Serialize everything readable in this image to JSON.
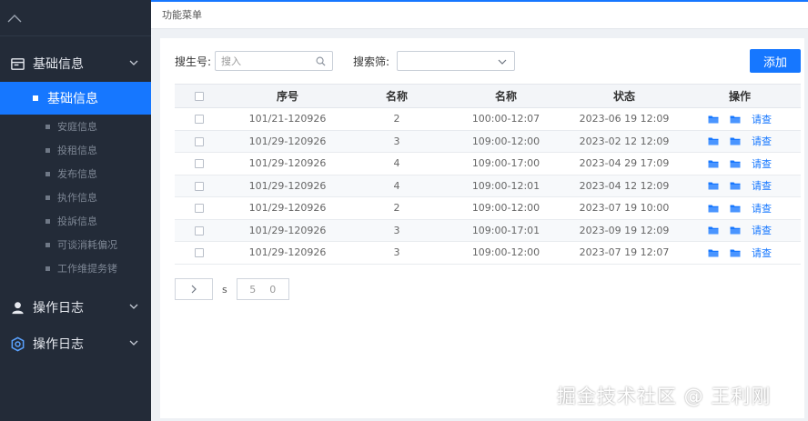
{
  "sidebar": {
    "groups": [
      {
        "label": "基础信息",
        "icon": "app-window-icon"
      },
      {
        "label": "操作日志",
        "icon": "user-icon"
      },
      {
        "label": "操作日志",
        "icon": "hexagon-settings-icon"
      }
    ],
    "active_item": "基础信息",
    "sub_items": [
      "安庭信息",
      "投租信息",
      "发布信息",
      "执作信息",
      "投訴信息",
      "可谈消耗偏况",
      "工作维提务铐"
    ]
  },
  "header": {
    "title": "功能菜单"
  },
  "filters": {
    "number_label": "搜生号:",
    "number_placeholder": "搜入",
    "search_label": "搜索筛:",
    "search_value": ""
  },
  "toolbar": {
    "add_label": "添加"
  },
  "table": {
    "columns": [
      "序号",
      "名称",
      "名称",
      "状态",
      "操作"
    ],
    "view_label": "请查",
    "rows": [
      [
        "101/21-120926",
        "2",
        "100:00-12:07",
        "2023-06 19 12:09"
      ],
      [
        "101/29-120926",
        "3",
        "109:00-12:00",
        "2023-02 12 12:09"
      ],
      [
        "101/29-120926",
        "4",
        "109:00-17:00",
        "2023-04 29 17:09"
      ],
      [
        "101/29-120926",
        "4",
        "109:00-12:01",
        "2023-04 12 12:09"
      ],
      [
        "101/29-120926",
        "2",
        "109:00-12:00",
        "2023-07 19 10:00"
      ],
      [
        "101/29-120926",
        "3",
        "109:00-17:01",
        "2023-09 19 12:09"
      ],
      [
        "101/29-120926",
        "3",
        "109:00-12:00",
        "2023-07 19 12:07"
      ]
    ]
  },
  "pager": {
    "text": "s",
    "box_left": "5",
    "box_right": "0"
  },
  "watermark": "掘金技术社区 @ 王利刚",
  "colors": {
    "sidebar_bg": "#232b38",
    "accent": "#1677ff",
    "page_bg": "#eef1f5"
  }
}
